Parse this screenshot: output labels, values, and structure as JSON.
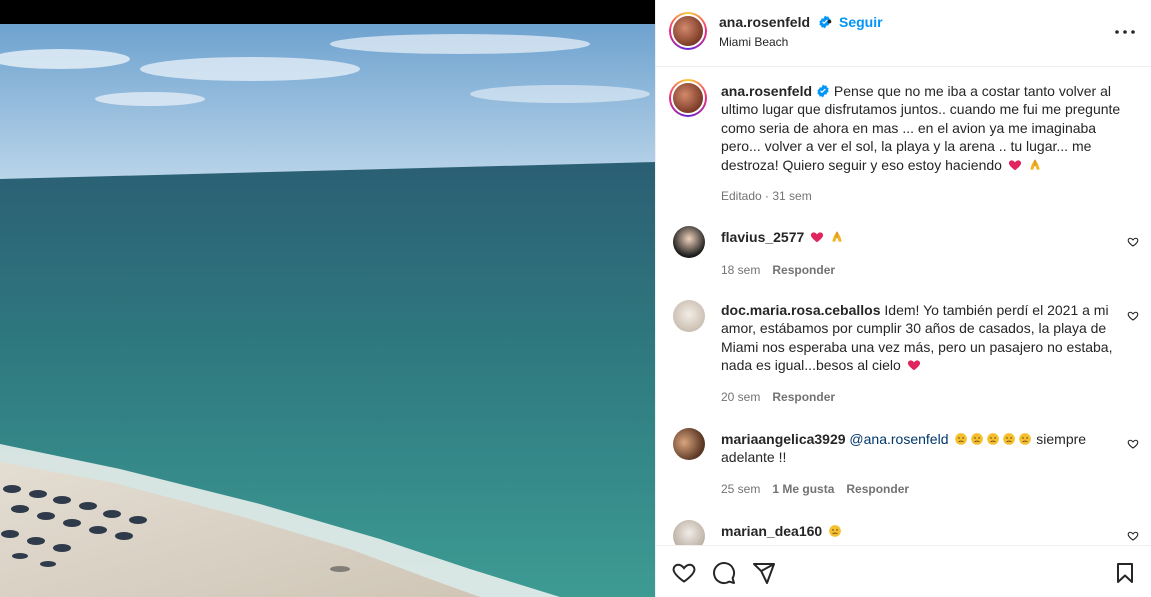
{
  "post": {
    "username": "ana.rosenfeld",
    "follow_label": "Seguir",
    "dot": "•",
    "location": "Miami Beach",
    "caption": "Pense que no me iba a costar tanto volver al ultimo lugar que disfrutamos juntos.. cuando me fui me pregunte como seria de ahora en mas ... en el avion ya me imaginaba pero... volver a ver el sol, la playa y la arena .. tu lugar... me destroza! Quiero seguir y eso estoy haciendo",
    "caption_meta": "Editado · 31 sem"
  },
  "comments": [
    {
      "username": "flavius_2577",
      "text": "",
      "time": "18 sem",
      "likes": "",
      "reply": "Responder"
    },
    {
      "username": "doc.maria.rosa.ceballos",
      "text": "Idem! Yo también perdí el 2021 a mi amor, estábamos por cumplir 30 años de casados, la playa de Miami nos esperaba una vez más, pero un pasajero no estaba, nada es igual...besos al cielo",
      "time": "20 sem",
      "likes": "",
      "reply": "Responder"
    },
    {
      "username": "mariaangelica3929",
      "mention": "@ana.rosenfeld",
      "text": "siempre adelante !!",
      "time": "25 sem",
      "likes": "1 Me gusta",
      "reply": "Responder"
    },
    {
      "username": "marian_dea160",
      "text": "",
      "time": "",
      "likes": "",
      "reply": ""
    }
  ],
  "icons": {
    "more": "more-options-icon",
    "like": "heart-icon",
    "comment": "comment-icon",
    "share": "share-icon",
    "save": "bookmark-icon"
  },
  "colors": {
    "link": "#0095f6",
    "muted": "#737373",
    "text": "#262626",
    "heart_red": "#e0245e"
  }
}
